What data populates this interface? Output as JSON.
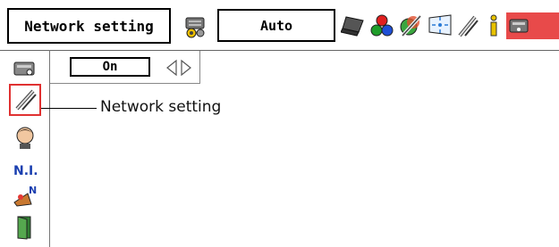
{
  "menu": {
    "title": "Network setting",
    "mode": "Auto"
  },
  "toolbar": {
    "icons": [
      "projector-input-icon",
      "laptop-icon",
      "color-balls-icon",
      "image-adjust-icon",
      "screen-icon",
      "setting-tools-icon",
      "information-icon",
      "network-icon"
    ]
  },
  "sidebar": {
    "icons": [
      "projector-icon",
      "network-setting-icon",
      "person-icon",
      "ni-icon",
      "network-upgrade-icon",
      "exit-door-icon"
    ],
    "ni_label": "N.I.",
    "n_label": "N"
  },
  "setting": {
    "value": "On"
  },
  "callout": {
    "text": "Network setting"
  },
  "colors": {
    "selection": "#e03131",
    "border": "#000000"
  }
}
